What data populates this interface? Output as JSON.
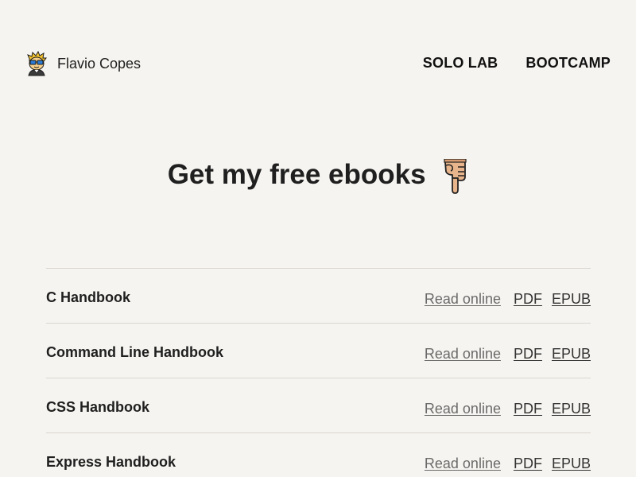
{
  "header": {
    "brand_name": "Flavio Copes",
    "nav": [
      {
        "label": "SOLO LAB"
      },
      {
        "label": "BOOTCAMP"
      }
    ]
  },
  "hero": {
    "title": "Get my free ebooks",
    "icon": "pointing-down-hand-icon"
  },
  "ebooks": [
    {
      "title": "C Handbook",
      "read_label": "Read online",
      "pdf_label": "PDF",
      "epub_label": "EPUB"
    },
    {
      "title": "Command Line Handbook",
      "read_label": "Read online",
      "pdf_label": "PDF",
      "epub_label": "EPUB"
    },
    {
      "title": "CSS Handbook",
      "read_label": "Read online",
      "pdf_label": "PDF",
      "epub_label": "EPUB"
    },
    {
      "title": "Express Handbook",
      "read_label": "Read online",
      "pdf_label": "PDF",
      "epub_label": "EPUB"
    }
  ],
  "colors": {
    "background": "#f6f4f0",
    "text": "#1f1f1f",
    "divider": "#d9d6d0"
  }
}
